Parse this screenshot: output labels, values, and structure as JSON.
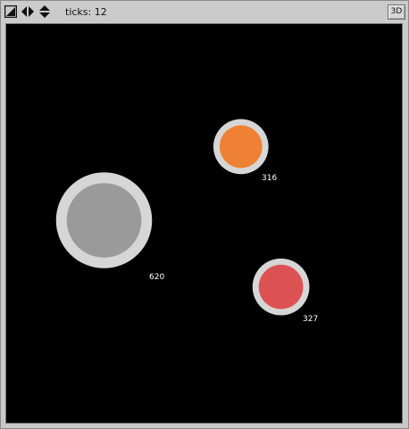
{
  "toolbar": {
    "icons": [
      "resize-diagonal-icon",
      "horizontal-arrows-icon",
      "vertical-arrows-icon"
    ],
    "ticks_label": "ticks: 12",
    "view_toggle_label": "3D"
  },
  "world": {
    "background": "#000000",
    "agents": [
      {
        "label": "316",
        "ring_color": "#d6d6d6",
        "fill_color": "#ee8133"
      },
      {
        "label": "620",
        "ring_color": "#d6d6d6",
        "fill_color": "#9a9a9a"
      },
      {
        "label": "327",
        "ring_color": "#d6d6d6",
        "fill_color": "#dc5252"
      }
    ]
  }
}
